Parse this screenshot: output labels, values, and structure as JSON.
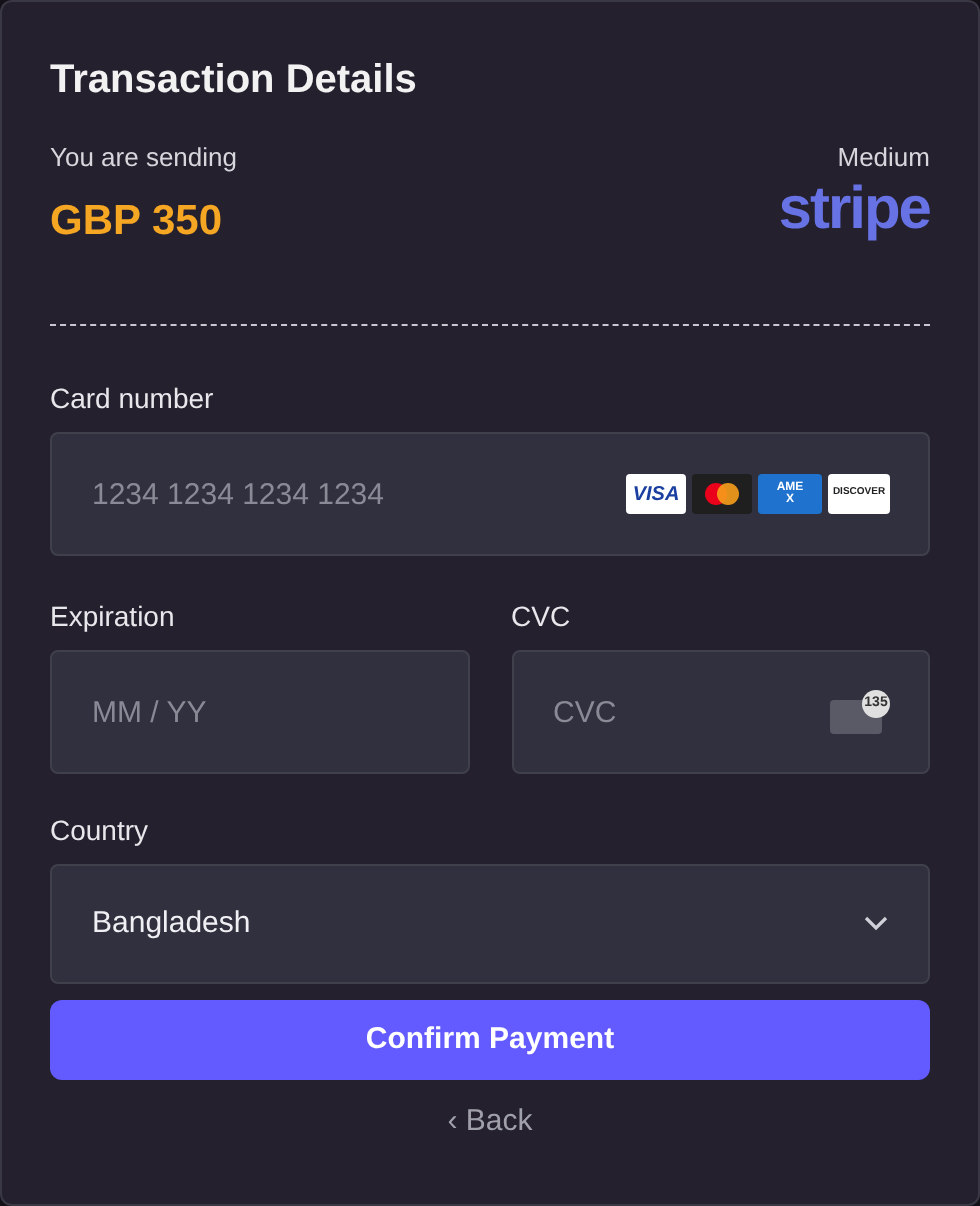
{
  "title": "Transaction Details",
  "sending": {
    "label": "You are sending",
    "amount": "GBP 350"
  },
  "medium": {
    "label": "Medium",
    "logo": "stripe"
  },
  "card_number": {
    "label": "Card number",
    "placeholder": "1234 1234 1234 1234",
    "brands": [
      {
        "kind": "visa",
        "text": "VISA"
      },
      {
        "kind": "mastercard"
      },
      {
        "kind": "amex",
        "text": "AMEX"
      },
      {
        "kind": "discover",
        "text": "DISCOVER"
      }
    ]
  },
  "expiration": {
    "label": "Expiration",
    "placeholder": "MM / YY"
  },
  "cvc": {
    "label": "CVC",
    "placeholder": "CVC",
    "icon_text": "135"
  },
  "country": {
    "label": "Country",
    "value": "Bangladesh"
  },
  "confirm_button": "Confirm Payment",
  "back_link": {
    "icon": "‹",
    "label": "Back"
  }
}
